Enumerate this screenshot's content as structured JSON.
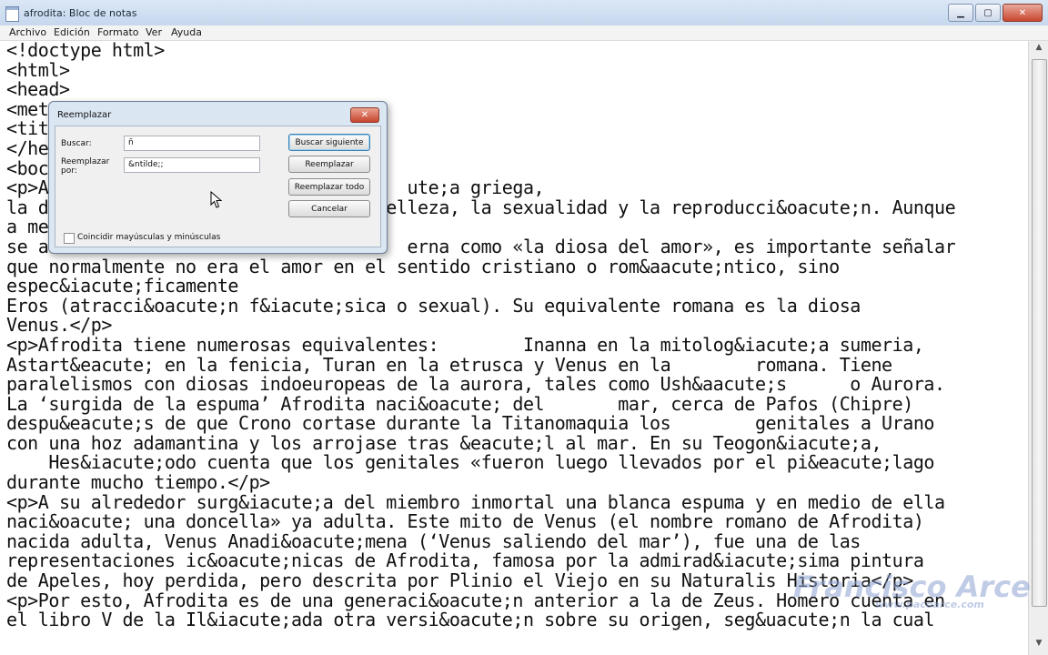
{
  "window": {
    "title": "afrodita: Bloc de notas"
  },
  "menu": [
    "Archivo",
    "Edición",
    "Formato",
    "Ver",
    "Ayuda"
  ],
  "editor_lines": [
    "<!doctype html>",
    "<html>",
    "<head>",
    "<met",
    "<tit",
    "</he",
    "<boc",
    "<p>A                                  ute;a griega,",
    "la d                               belleza, la sexualidad y la reproducci&oacute;n. Aunque",
    "a me",
    "se a                                  erna como «la diosa del amor», es importante señalar",
    "que normalmente no era el amor en el sentido cristiano o rom&aacute;ntico, sino",
    "espec&iacute;ficamente",
    "Eros (atracci&oacute;n f&iacute;sica o sexual). Su equivalente romana es la diosa",
    "Venus.</p>",
    "<p>Afrodita tiene numerosas equivalentes:        Inanna en la mitolog&iacute;a sumeria,",
    "Astart&eacute; en la fenicia, Turan en la etrusca y Venus en la        romana. Tiene",
    "paralelismos con diosas indoeuropeas de la aurora, tales como Ush&aacute;s      o Aurora.",
    "La ‘surgida de la espuma’ Afrodita naci&oacute; del       mar, cerca de Pafos (Chipre)",
    "despu&eacute;s de que Crono cortase durante la Titanomaquia los        genitales a Urano",
    "con una hoz adamantina y los arrojase tras &eacute;l al mar. En su Teogon&iacute;a,",
    "    Hes&iacute;odo cuenta que los genitales «fueron luego llevados por el pi&eacute;lago",
    "durante mucho tiempo.</p>",
    "<p>A su alrededor surg&iacute;a del miembro inmortal una blanca espuma y en medio de ella",
    "naci&oacute; una doncella» ya adulta. Este mito de Venus (el nombre romano de Afrodita)",
    "nacida adulta, Venus Anadi&oacute;mena (‘Venus saliendo del mar’), fue una de las",
    "representaciones ic&oacute;nicas de Afrodita, famosa por la admirad&iacute;sima pintura",
    "de Apeles, hoy perdida, pero descrita por Plinio el Viejo en su Naturalis Historia</p>",
    "<p>Por esto, Afrodita es de una generaci&oacute;n anterior a la de Zeus. Homero cuenta en",
    "el libro V de la Il&iacute;ada otra versi&oacute;n sobre su origen, seg&uacute;n la cual"
  ],
  "dialog": {
    "title": "Reemplazar",
    "find_label": "Buscar:",
    "find_value": "ñ",
    "replace_label": "Reemplazar por:",
    "replace_value": "&ntilde;;",
    "match_case_label": "Coincidir mayúsculas y minúsculas",
    "match_case_checked": false,
    "buttons": {
      "find_next": "Buscar siguiente",
      "replace": "Reemplazar",
      "replace_all": "Reemplazar todo",
      "cancel": "Cancelar"
    }
  },
  "watermark": {
    "name": "Francisco Arce",
    "url": "www.pacoarce.com"
  }
}
